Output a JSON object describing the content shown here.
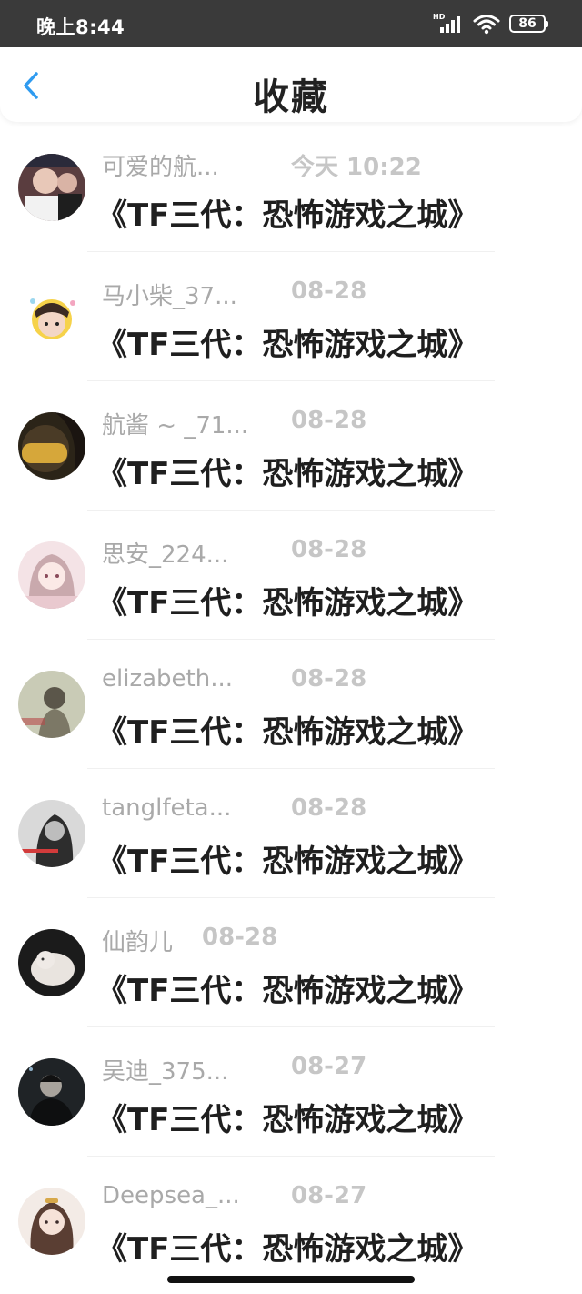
{
  "status_bar": {
    "time": "晚上8:44",
    "network_label": "HD",
    "battery_level": "86",
    "icons": [
      "signal-icon",
      "wifi-icon",
      "battery-icon"
    ]
  },
  "header": {
    "title": "收藏",
    "back_icon": "chevron-left-icon",
    "accent_color": "#2f9bf0"
  },
  "favorites": [
    {
      "username": "可爱的航...",
      "date": "今天 10:22",
      "title": "《TF三代：恐怖游戏之城》"
    },
    {
      "username": "马小柴_37...",
      "date": "08-28",
      "title": "《TF三代：恐怖游戏之城》"
    },
    {
      "username": "航酱 ~ _71...",
      "date": "08-28",
      "title": "《TF三代：恐怖游戏之城》"
    },
    {
      "username": "思安_224...",
      "date": "08-28",
      "title": "《TF三代：恐怖游戏之城》"
    },
    {
      "username": "elizabeth...",
      "date": "08-28",
      "title": "《TF三代：恐怖游戏之城》"
    },
    {
      "username": "tanglfeta...",
      "date": "08-28",
      "title": "《TF三代：恐怖游戏之城》"
    },
    {
      "username": "仙韵儿",
      "date": "08-28",
      "title": "《TF三代：恐怖游戏之城》"
    },
    {
      "username": "吴迪_375...",
      "date": "08-27",
      "title": "《TF三代：恐怖游戏之城》"
    },
    {
      "username": "Deepsea_...",
      "date": "08-27",
      "title": "《TF三代：恐怖游戏之城》"
    }
  ]
}
